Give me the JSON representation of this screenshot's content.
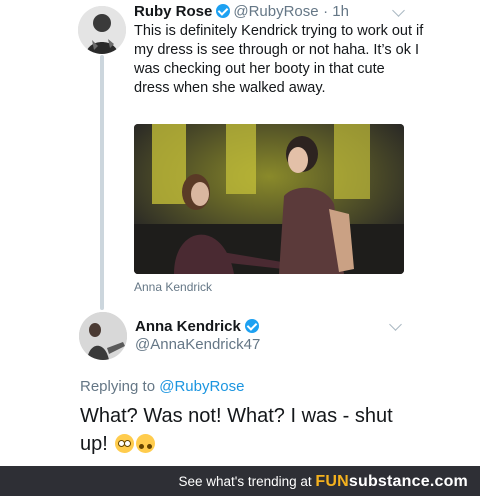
{
  "tweet1": {
    "display_name": "Ruby Rose",
    "handle": "@RubyRose",
    "time": "· 1h",
    "text": "This is definitely Kendrick trying to work out if my dress is see through or not haha. It’s ok I was checking out her booty in that cute dress when she walked away.",
    "photo_caption": "Anna Kendrick"
  },
  "tweet2": {
    "display_name": "Anna Kendrick",
    "handle": "@AnnaKendrick47",
    "replying_prefix": "Replying to",
    "replying_to": "@RubyRose",
    "text": "What? Was not! What? I was - shut up!",
    "emojis": [
      "flushed-face",
      "upside-down-face"
    ]
  },
  "footer": {
    "text": "See what's trending at",
    "brand_part1": "FUN",
    "brand_part2": "substance",
    "brand_part3": ".com"
  },
  "colors": {
    "verified": "#1da1f2",
    "link": "#1b95e0",
    "muted": "#657786",
    "footer_bg": "#2e2f35",
    "brand_accent": "#f5b21e"
  }
}
